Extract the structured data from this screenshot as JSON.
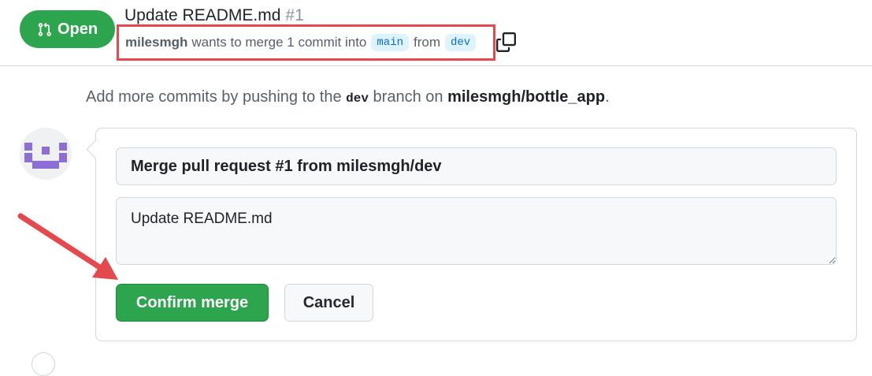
{
  "pr": {
    "state": "Open",
    "title": "Update README.md",
    "number": "#1",
    "author": "milesmgh",
    "merge_text": "wants to merge 1 commit into",
    "base_branch": "main",
    "from_text": "from",
    "head_branch": "dev"
  },
  "hint": {
    "prefix": "Add more commits by pushing to the",
    "branch": "dev",
    "middle": "branch on",
    "repo": "milesmgh/bottle_app",
    "suffix": "."
  },
  "merge_form": {
    "commit_title": "Merge pull request #1 from milesmgh/dev",
    "commit_body": "Update README.md",
    "confirm_label": "Confirm merge",
    "cancel_label": "Cancel"
  },
  "colors": {
    "open_green": "#2da44e",
    "highlight_red": "#e5484d",
    "branch_blue": "#0969da",
    "branch_bg": "#ddf4ff"
  },
  "icons": {
    "state": "git-pull-request-icon",
    "copy": "copy-icon",
    "annotation": "red-arrow-annotation"
  }
}
